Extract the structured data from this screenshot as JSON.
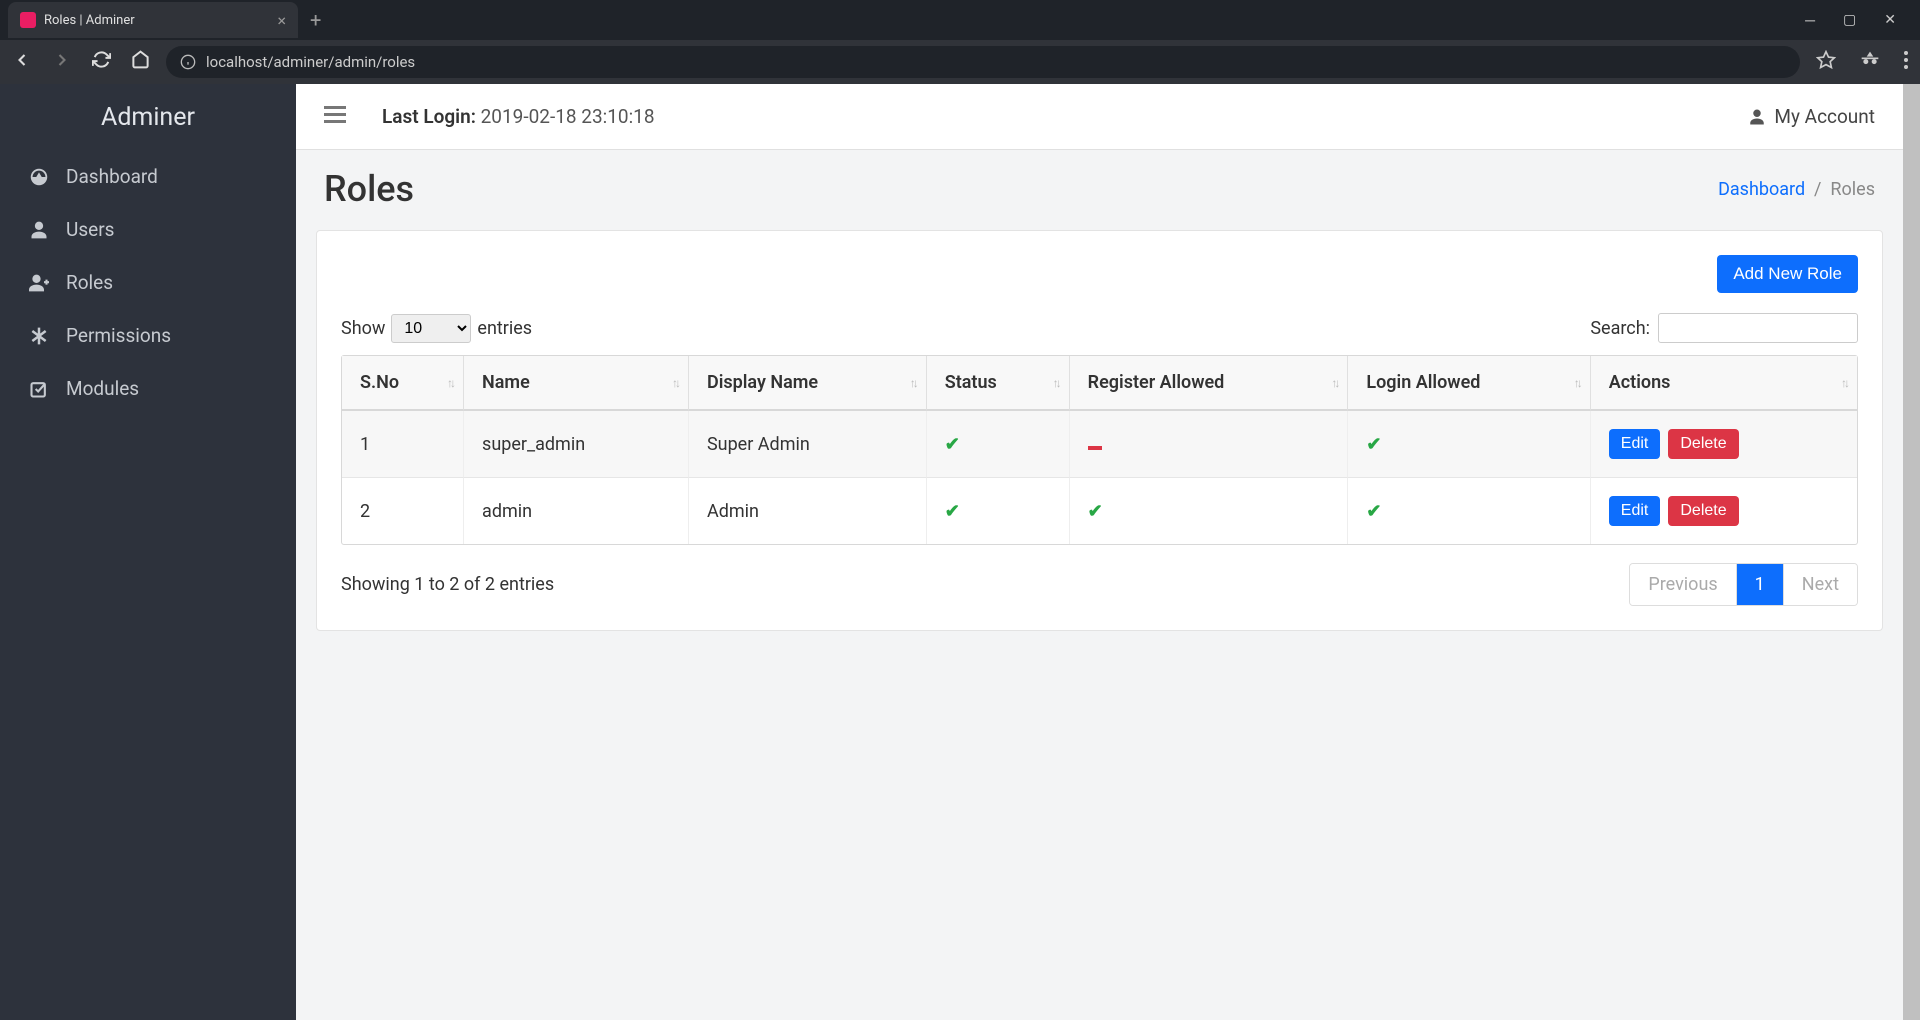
{
  "browser": {
    "tab_title": "Roles | Adminer",
    "url": "localhost/adminer/admin/roles"
  },
  "sidebar": {
    "brand": "Adminer",
    "items": [
      {
        "icon": "gauge-icon",
        "label": "Dashboard"
      },
      {
        "icon": "user-icon",
        "label": "Users"
      },
      {
        "icon": "user-plus-icon",
        "label": "Roles"
      },
      {
        "icon": "asterisk-icon",
        "label": "Permissions"
      },
      {
        "icon": "check-square-icon",
        "label": "Modules"
      }
    ]
  },
  "header": {
    "last_login_label": "Last Login:",
    "last_login_value": "2019-02-18 23:10:18",
    "account_label": "My Account"
  },
  "page": {
    "title": "Roles",
    "breadcrumb_home": "Dashboard",
    "breadcrumb_current": "Roles",
    "add_button": "Add New Role"
  },
  "datatable": {
    "show_label": "Show",
    "entries_label": "entries",
    "length_value": "10",
    "search_label": "Search:",
    "columns": [
      "S.No",
      "Name",
      "Display Name",
      "Status",
      "Register Allowed",
      "Login Allowed",
      "Actions"
    ],
    "rows": [
      {
        "sno": "1",
        "name": "super_admin",
        "display": "Super Admin",
        "status": true,
        "register": false,
        "login": true
      },
      {
        "sno": "2",
        "name": "admin",
        "display": "Admin",
        "status": true,
        "register": true,
        "login": true
      }
    ],
    "edit_label": "Edit",
    "delete_label": "Delete",
    "info": "Showing 1 to 2 of 2 entries",
    "prev": "Previous",
    "next": "Next",
    "page": "1"
  }
}
